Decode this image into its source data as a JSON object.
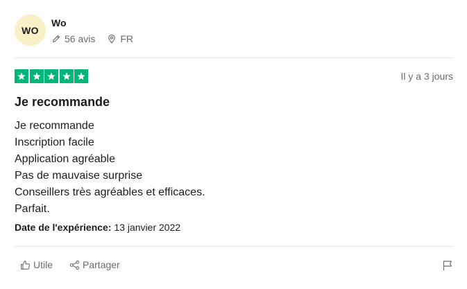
{
  "reviewer": {
    "initials": "WO",
    "name": "Wo",
    "reviews_count": "56 avis",
    "country": "FR",
    "avatar_color": "#faf0c8"
  },
  "rating": {
    "stars": 5,
    "max": 5,
    "color": "#00b67a"
  },
  "review": {
    "time_ago": "Il y a 3 jours",
    "title": "Je recommande",
    "lines": [
      "Je recommande",
      "Inscription facile",
      "Application agréable",
      "Pas de mauvaise surprise",
      "Conseillers très agréables et efficaces.",
      "Parfait."
    ],
    "experience_label": "Date de l'expérience:",
    "experience_date": "13 janvier 2022"
  },
  "actions": {
    "useful_label": "Utile",
    "share_label": "Partager"
  },
  "icons": {
    "reviews": "pencil-icon",
    "country": "location-pin-icon",
    "useful": "thumbs-up-icon",
    "share": "share-icon",
    "report": "flag-icon",
    "star": "star-icon"
  }
}
